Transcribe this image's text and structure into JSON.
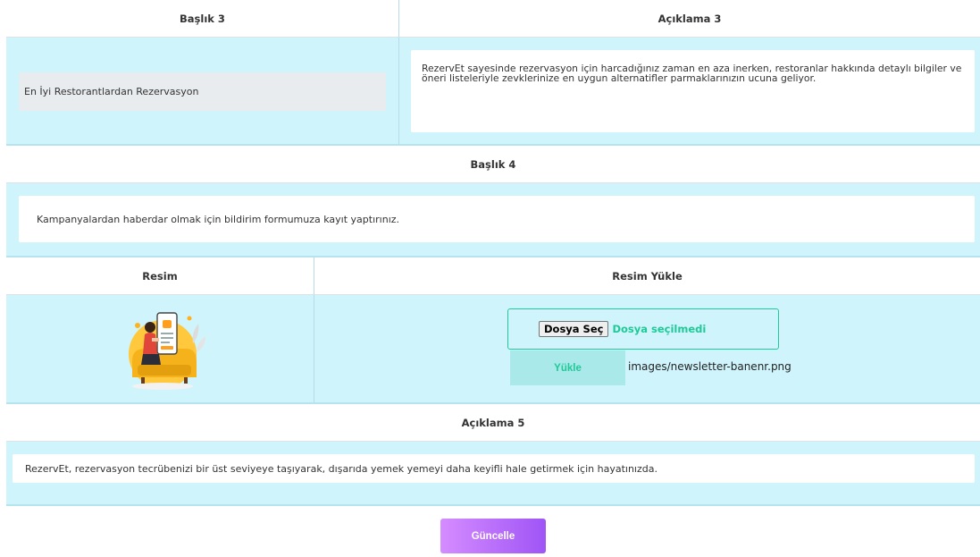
{
  "section3": {
    "col1_header": "Başlık 3",
    "col2_header": "Açıklama 3",
    "title_value": "En İyi Restorantlardan Rezervasyon",
    "description_value": "RezervEt sayesinde rezervasyon için harcadığınız zaman en aza inerken, restoranlar hakkında detaylı bilgiler ve öneri listeleriyle zevklerinize en uygun alternatifler parmaklarınızın ucuna geliyor."
  },
  "section4": {
    "header": "Başlık 4",
    "value": "Kampanyalardan haberdar olmak için bildirim formumuza kayıt yaptırınız."
  },
  "image_section": {
    "col1_header": "Resim",
    "col2_header": "Resim Yükle",
    "file_button": "Dosya Seç",
    "file_status": "Dosya seçilmedi",
    "upload_button": "Yükle",
    "image_path": "images/newsletter-banenr.png"
  },
  "section5": {
    "header": "Açıklama 5",
    "value": "RezervEt, rezervasyon tecrübenizi bir üst seviyeye taşıyarak, dışarıda yemek yemeyi daha keyifli hale getirmek için hayatınızda."
  },
  "actions": {
    "update_button": "Güncelle"
  },
  "colors": {
    "row_background": "#cff4fc",
    "accent_teal": "#20c997",
    "button_gradient_start": "#d58cff",
    "button_gradient_end": "#9f55f5"
  }
}
